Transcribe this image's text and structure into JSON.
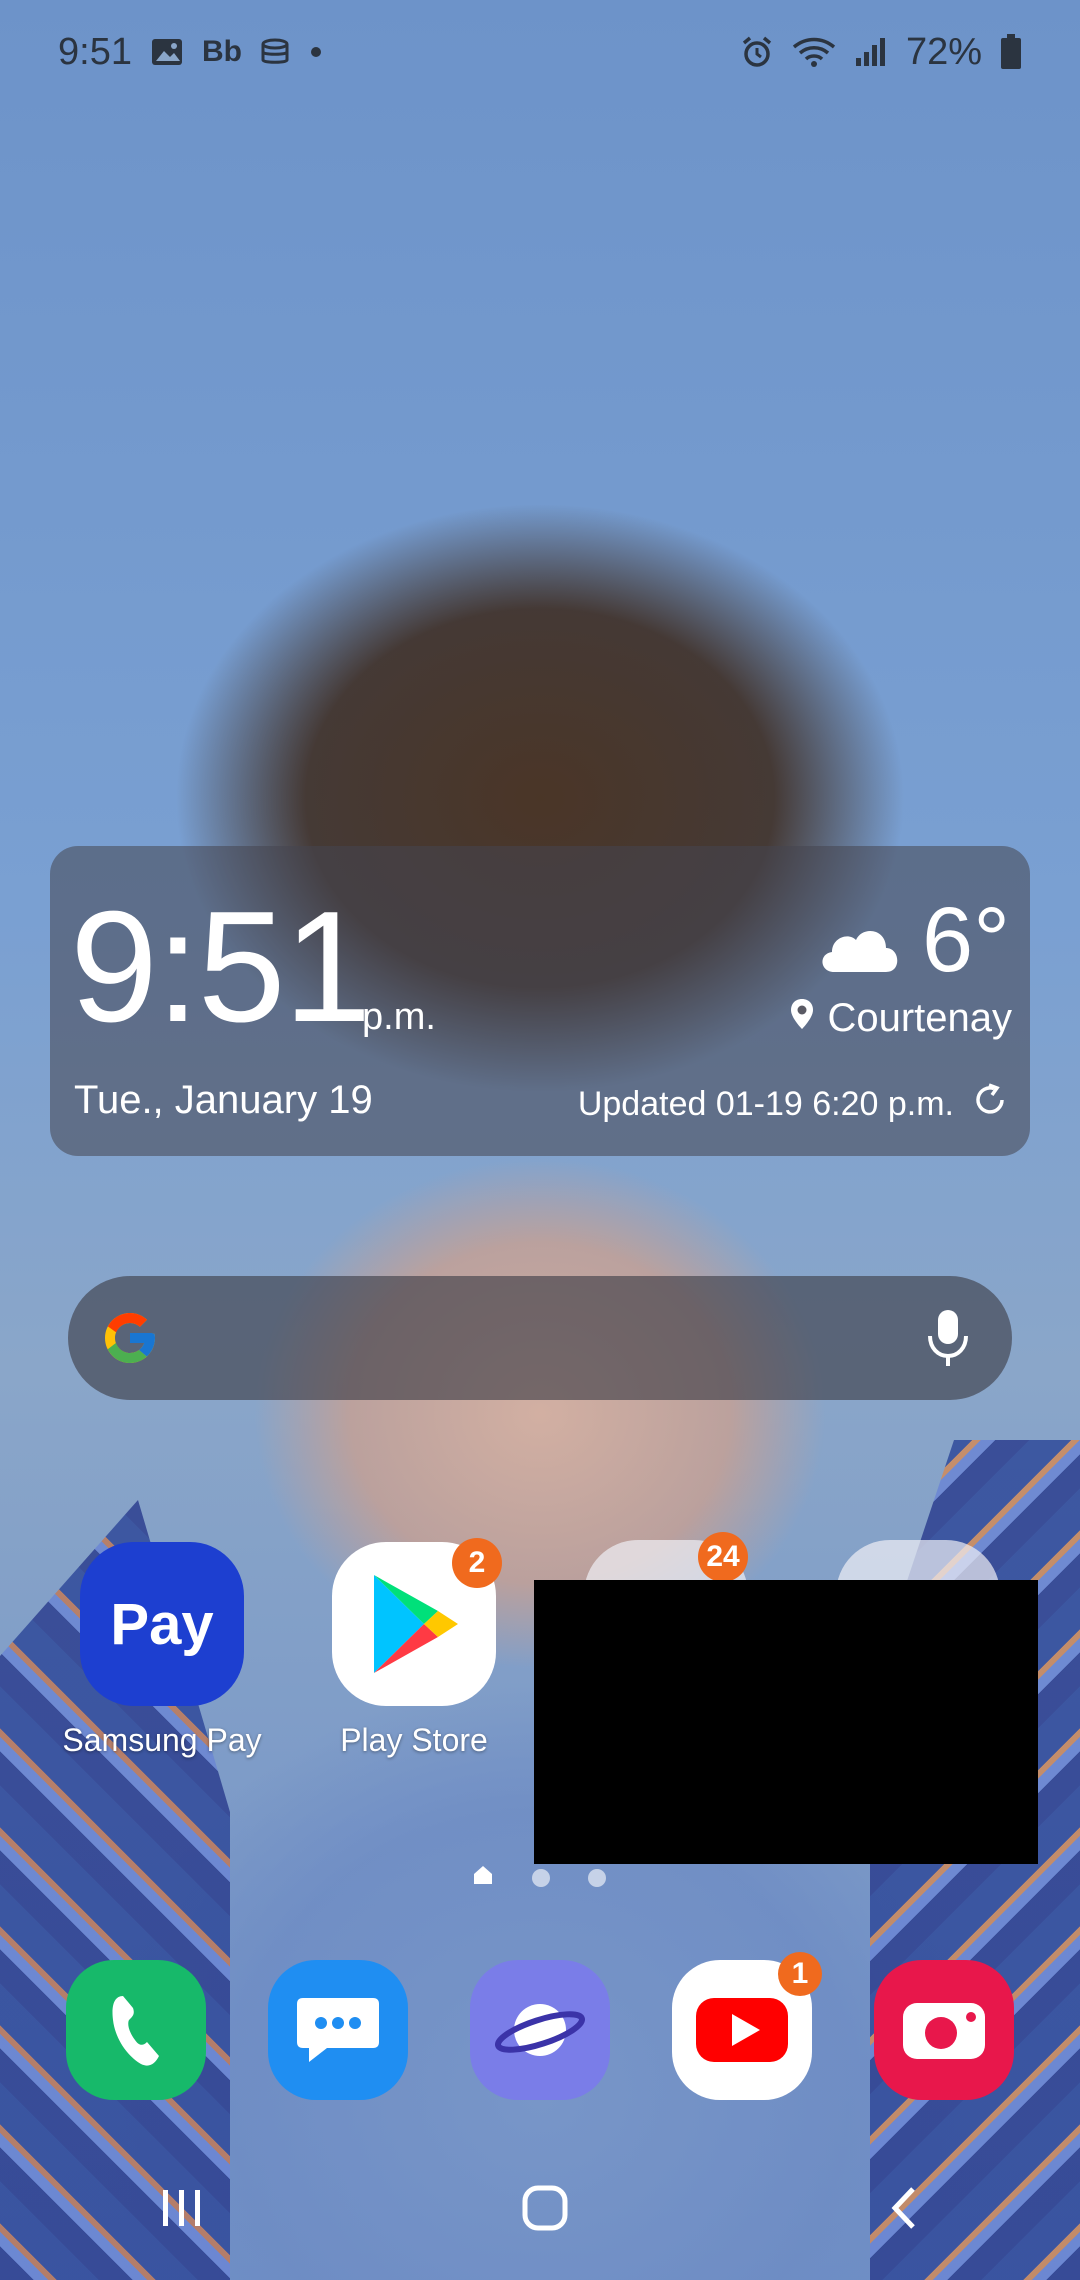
{
  "status_bar": {
    "time": "9:51",
    "notification_icons": [
      "gallery-icon",
      "blackboard-icon",
      "storage-icon",
      "dot-icon"
    ],
    "system_icons": [
      "alarm-icon",
      "wifi-icon",
      "signal-icon"
    ],
    "battery": "72%"
  },
  "clock_widget": {
    "time": "9:51",
    "ampm": "p.m.",
    "date": "Tue., January 19",
    "temperature": "6°",
    "weather_icon": "cloud-icon",
    "location": "Courtenay",
    "updated": "Updated 01-19 6:20 p.m."
  },
  "search_bar": {
    "logo": "google-g-icon",
    "mic": "mic-icon"
  },
  "apps": [
    {
      "label": "Samsung Pay",
      "icon_text": "Pay",
      "color": "#1d3fd0"
    },
    {
      "label": "Play Store",
      "badge": "2",
      "color": "#ffffff"
    }
  ],
  "folders": [
    {
      "badge": "24"
    },
    {}
  ],
  "dock": [
    {
      "name": "phone",
      "color": "#17b96a"
    },
    {
      "name": "messages",
      "color": "#1f8ef2"
    },
    {
      "name": "internet",
      "color": "#7a7de8"
    },
    {
      "name": "youtube",
      "color": "#ffffff",
      "badge": "1"
    },
    {
      "name": "camera",
      "color": "#e8174b"
    }
  ],
  "pager": {
    "pages": 3,
    "current": 1
  },
  "accent": "#f06a1e"
}
